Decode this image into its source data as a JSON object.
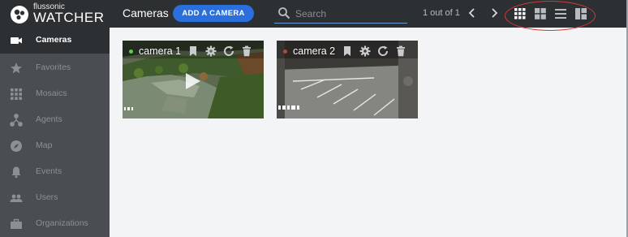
{
  "brand": {
    "small": "flussonic",
    "big": "WATCHER"
  },
  "header": {
    "title": "Cameras",
    "add_button": "ADD A CAMERA",
    "search_placeholder": "Search",
    "pager": "1 out of 1"
  },
  "sidebar": {
    "items": [
      {
        "label": "Cameras",
        "icon": "video-camera-icon",
        "active": true
      },
      {
        "label": "Favorites",
        "icon": "star-icon"
      },
      {
        "label": "Mosaics",
        "icon": "grid-icon"
      },
      {
        "label": "Agents",
        "icon": "agents-icon"
      },
      {
        "label": "Map",
        "icon": "compass-icon"
      },
      {
        "label": "Events",
        "icon": "bell-icon"
      },
      {
        "label": "Users",
        "icon": "users-icon"
      },
      {
        "label": "Organizations",
        "icon": "briefcase-icon"
      }
    ]
  },
  "cameras": [
    {
      "name": "camera 1",
      "status": "online",
      "status_color": "#5bd33a"
    },
    {
      "name": "camera 2",
      "status": "offline",
      "status_color": "#d33a2a"
    }
  ],
  "colors": {
    "topbar": "#2d3033",
    "sidebar": "#4a4d51",
    "accent": "#2a6fdb",
    "highlight": "#d33a3a"
  }
}
